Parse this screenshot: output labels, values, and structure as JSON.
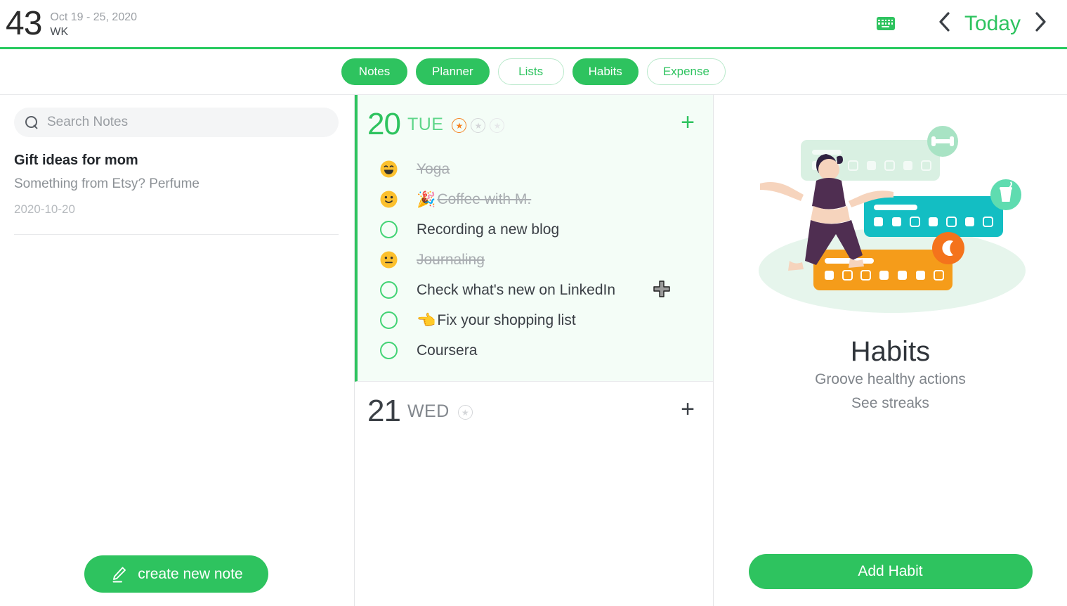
{
  "header": {
    "week_number": "43",
    "week_range": "Oct 19 - 25, 2020",
    "week_label": "WK",
    "keyboard_icon": "keyboard-icon",
    "prev_label": "‹",
    "today_label": "Today",
    "next_label": "›"
  },
  "tabs": [
    {
      "label": "Notes",
      "style": "filled"
    },
    {
      "label": "Planner",
      "style": "filled"
    },
    {
      "label": "Lists",
      "style": "outline"
    },
    {
      "label": "Habits",
      "style": "filled"
    },
    {
      "label": "Expense",
      "style": "outline"
    }
  ],
  "notes_panel": {
    "search_placeholder": "Search Notes",
    "search_value": "",
    "search_icon": "search-icon",
    "notes": [
      {
        "title": "Gift ideas for mom",
        "snippet": "Something from Etsy? Perfume",
        "date": "2020-10-20"
      }
    ],
    "create_button_label": "create new note",
    "create_button_icon": "pencil-icon"
  },
  "planner_panel": {
    "days": [
      {
        "number": "20",
        "weekday": "TUE",
        "active": true,
        "stars": [
          "on",
          "off",
          "faint"
        ],
        "add_label": "+",
        "tasks": [
          {
            "text": "Yoga",
            "done": true,
            "emoji": "",
            "mood": "grin"
          },
          {
            "text": "Coffee with M.",
            "done": true,
            "emoji": "🎉",
            "mood": "smile"
          },
          {
            "text": "Recording a new blog",
            "done": false,
            "emoji": "",
            "mood": ""
          },
          {
            "text": "Journaling",
            "done": true,
            "emoji": "",
            "mood": "neutral"
          },
          {
            "text": "Check what's new on LinkedIn",
            "done": false,
            "emoji": "",
            "mood": ""
          },
          {
            "text": "Fix your shopping list",
            "done": false,
            "emoji": "👈",
            "mood": ""
          },
          {
            "text": "Coursera",
            "done": false,
            "emoji": "",
            "mood": ""
          }
        ]
      },
      {
        "number": "21",
        "weekday": "WED",
        "active": false,
        "stars": [
          "off"
        ],
        "add_label": "+",
        "tasks": []
      }
    ]
  },
  "habits_panel": {
    "title": "Habits",
    "subtitle_line1": "Groove healthy actions",
    "subtitle_line2": "See streaks",
    "add_button_label": "Add Habit",
    "illustration": "yoga-habit-cards-illustration"
  },
  "colors": {
    "accent_green": "#2ec35f",
    "day_card_bg": "#f4fdf7",
    "star_on": "#f58220",
    "habit_card_teal": "#13bec3",
    "habit_card_orange": "#f59c1a",
    "habit_card_mint": "#dff3e6"
  }
}
